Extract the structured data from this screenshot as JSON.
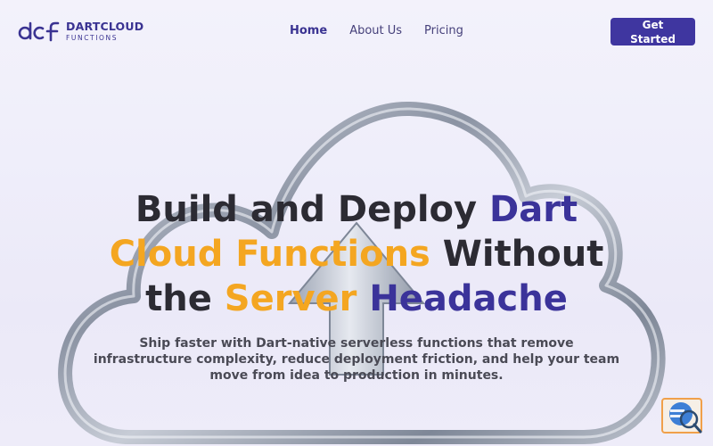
{
  "brand": {
    "name": "DARTCLOUD",
    "tagline": "FUNCTIONS",
    "logo_icon": "dcf-monogram",
    "color_primary": "#3b339a",
    "color_accent": "#f4a621"
  },
  "nav": {
    "items": [
      {
        "label": "Home",
        "active": true
      },
      {
        "label": "About Us",
        "active": false
      },
      {
        "label": "Pricing",
        "active": false
      }
    ]
  },
  "cta": {
    "label": "Get Started"
  },
  "hero": {
    "title_parts": [
      {
        "text": "Build and Deploy ",
        "color": "dark"
      },
      {
        "text": "Dart",
        "color": "purple"
      },
      {
        "text": "Cloud Functions",
        "color": "orange"
      },
      {
        "text": " Without",
        "color": "dark"
      },
      {
        "text": "the ",
        "color": "dark"
      },
      {
        "text": "Server",
        "color": "orange"
      },
      {
        "text": " Headache",
        "color": "purple"
      }
    ],
    "subtitle": "Ship faster with Dart-native serverless functions that remove infrastructure complexity, reduce deployment friction, and help your team move from idea to production in minutes.",
    "illustration_icon": "cloud-upload-icon"
  },
  "widget": {
    "icon": "search-chat-icon"
  }
}
